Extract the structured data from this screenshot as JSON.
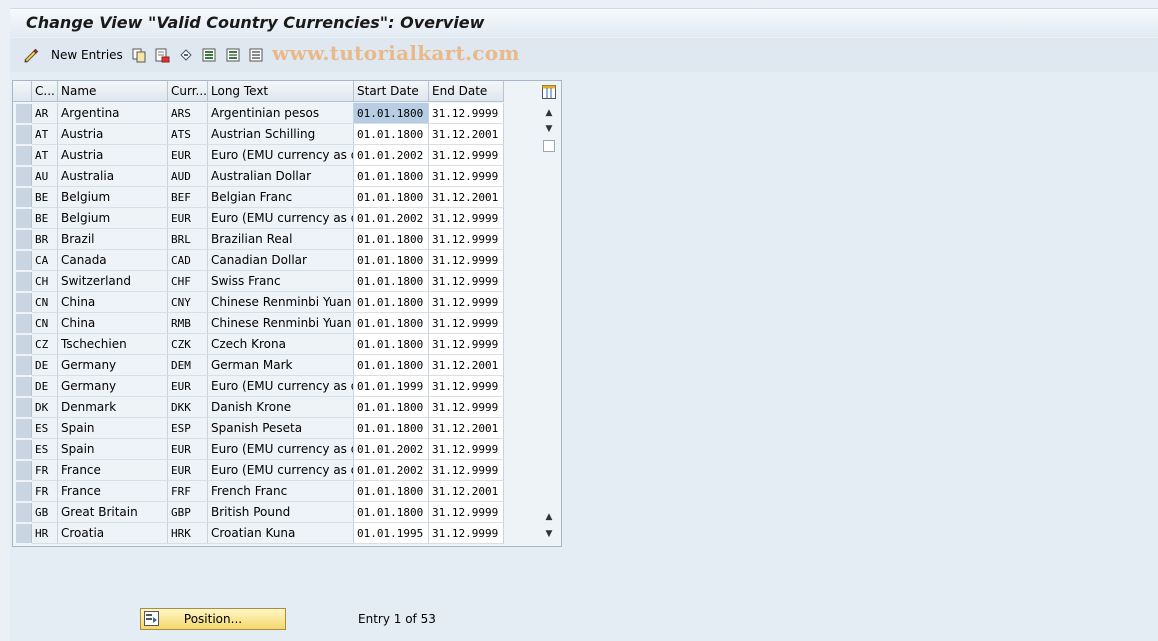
{
  "title": "Change View \"Valid Country Currencies\": Overview",
  "toolbar": {
    "new_entries_label": "New Entries",
    "watermark": "www.tutorialkart.com",
    "icons": [
      "pen-icon",
      "copy-icon",
      "delete-icon",
      "undo-icon",
      "select-all-icon",
      "select-block-icon",
      "deselect-all-icon"
    ]
  },
  "table": {
    "headers": [
      "C...",
      "Name",
      "Curr...",
      "Long Text",
      "Start Date",
      "End Date"
    ],
    "rows": [
      {
        "c": "AR",
        "name": "Argentina",
        "curr": "ARS",
        "long": "Argentinian pesos",
        "start": "01.01.1800",
        "end": "31.12.9999"
      },
      {
        "c": "AT",
        "name": "Austria",
        "curr": "ATS",
        "long": "Austrian Schilling",
        "start": "01.01.1800",
        "end": "31.12.2001"
      },
      {
        "c": "AT",
        "name": "Austria",
        "curr": "EUR",
        "long": "Euro (EMU currency as o…",
        "start": "01.01.2002",
        "end": "31.12.9999"
      },
      {
        "c": "AU",
        "name": "Australia",
        "curr": "AUD",
        "long": "Australian Dollar",
        "start": "01.01.1800",
        "end": "31.12.9999"
      },
      {
        "c": "BE",
        "name": "Belgium",
        "curr": "BEF",
        "long": "Belgian Franc",
        "start": "01.01.1800",
        "end": "31.12.2001"
      },
      {
        "c": "BE",
        "name": "Belgium",
        "curr": "EUR",
        "long": "Euro (EMU currency as o…",
        "start": "01.01.2002",
        "end": "31.12.9999"
      },
      {
        "c": "BR",
        "name": "Brazil",
        "curr": "BRL",
        "long": "Brazilian Real",
        "start": "01.01.1800",
        "end": "31.12.9999"
      },
      {
        "c": "CA",
        "name": "Canada",
        "curr": "CAD",
        "long": "Canadian Dollar",
        "start": "01.01.1800",
        "end": "31.12.9999"
      },
      {
        "c": "CH",
        "name": "Switzerland",
        "curr": "CHF",
        "long": "Swiss Franc",
        "start": "01.01.1800",
        "end": "31.12.9999"
      },
      {
        "c": "CN",
        "name": "China",
        "curr": "CNY",
        "long": "Chinese Renminbi Yuan",
        "start": "01.01.1800",
        "end": "31.12.9999"
      },
      {
        "c": "CN",
        "name": "China",
        "curr": "RMB",
        "long": "Chinese Renminbi Yuan",
        "start": "01.01.1800",
        "end": "31.12.9999"
      },
      {
        "c": "CZ",
        "name": "Tschechien",
        "curr": "CZK",
        "long": "Czech Krona",
        "start": "01.01.1800",
        "end": "31.12.9999"
      },
      {
        "c": "DE",
        "name": "Germany",
        "curr": "DEM",
        "long": "German Mark",
        "start": "01.01.1800",
        "end": "31.12.2001"
      },
      {
        "c": "DE",
        "name": "Germany",
        "curr": "EUR",
        "long": "Euro (EMU currency as o…",
        "start": "01.01.1999",
        "end": "31.12.9999"
      },
      {
        "c": "DK",
        "name": "Denmark",
        "curr": "DKK",
        "long": "Danish Krone",
        "start": "01.01.1800",
        "end": "31.12.9999"
      },
      {
        "c": "ES",
        "name": "Spain",
        "curr": "ESP",
        "long": "Spanish Peseta",
        "start": "01.01.1800",
        "end": "31.12.2001"
      },
      {
        "c": "ES",
        "name": "Spain",
        "curr": "EUR",
        "long": "Euro (EMU currency as o…",
        "start": "01.01.2002",
        "end": "31.12.9999"
      },
      {
        "c": "FR",
        "name": "France",
        "curr": "EUR",
        "long": "Euro (EMU currency as o…",
        "start": "01.01.2002",
        "end": "31.12.9999"
      },
      {
        "c": "FR",
        "name": "France",
        "curr": "FRF",
        "long": "French Franc",
        "start": "01.01.1800",
        "end": "31.12.2001"
      },
      {
        "c": "GB",
        "name": "Great Britain",
        "curr": "GBP",
        "long": "British Pound",
        "start": "01.01.1800",
        "end": "31.12.9999"
      },
      {
        "c": "HR",
        "name": "Croatia",
        "curr": "HRK",
        "long": "Croatian Kuna",
        "start": "01.01.1995",
        "end": "31.12.9999"
      }
    ]
  },
  "footer": {
    "position_button_label": "Position...",
    "entry_info": "Entry 1 of 53"
  }
}
